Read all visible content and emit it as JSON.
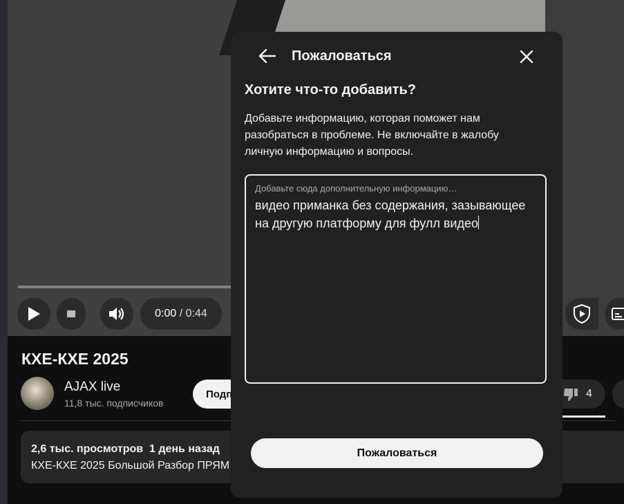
{
  "player": {
    "current_time": "0:00",
    "separator": "/",
    "duration": "0:44",
    "progress": 0
  },
  "video": {
    "title": "КХЕ-КХЕ 2025",
    "channel_name": "AJAX live",
    "subscribers": "11,8 тыс. подписчиков",
    "subscribe_label": "Подп",
    "dislike_count": "4",
    "views": "2,6 тыс. просмотров",
    "published": "1 день назад",
    "description_preview": "КХЕ-КХЕ 2025 Большой Разбор ПРЯМ"
  },
  "dialog": {
    "title": "Пожаловаться",
    "heading": "Хотите что-то добавить?",
    "description": "Добавьте информацию, которая поможет нам разобраться в проблеме. Не включайте в жалобу личную информацию и вопросы.",
    "textarea_label": "Добавьте сюда дополнительную информацию…",
    "textarea_value": "видео приманка без содержания, зазывающее на другую платформу для фулл видео",
    "submit_label": "Пожаловаться"
  },
  "icons": {
    "back": "arrow-left-icon",
    "close": "close-icon",
    "play": "play-icon",
    "miniplayer": "miniplayer-icon",
    "volume": "volume-icon",
    "shield": "shield-play-icon",
    "captions": "captions-icon",
    "dislike": "thumbs-down-icon"
  }
}
